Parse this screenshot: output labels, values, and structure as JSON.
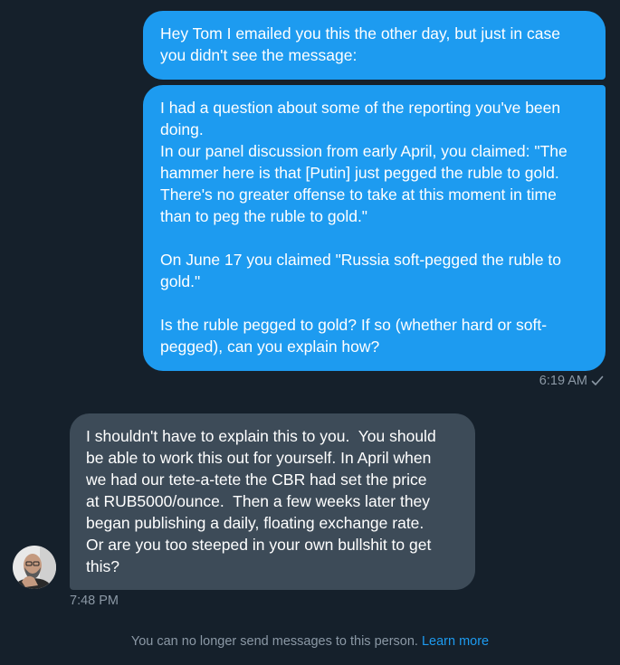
{
  "conversation": {
    "sent_messages": [
      {
        "text": "Hey Tom I emailed you this the other day, but just in case\nyou didn't see the message:"
      },
      {
        "text": "I had a question about some of the reporting you've been\ndoing.\nIn our panel discussion from early April, you claimed: \"The\nhammer here is that [Putin] just pegged the ruble to gold.\nThere's no greater offense to take at this moment in time\nthan to peg the ruble to gold.\"\n\nOn June 17 you claimed \"Russia soft-pegged the ruble to\ngold.\"\n\nIs the ruble pegged to gold? If so (whether hard or soft-\npegged), can you explain how?"
      }
    ],
    "sent_time": "6:19 AM",
    "sent_status_icon": "check-icon",
    "received_message": {
      "text": "I shouldn't have to explain this to you.  You should\nbe able to work this out for yourself. In April when\nwe had our tete-a-tete the CBR had set the price\nat RUB5000/ounce.  Then a few weeks later they\nbegan publishing a daily, floating exchange rate.\nOr are you too steeped in your own bullshit to get\nthis?"
    },
    "received_time": "7:48 PM",
    "footer": {
      "notice": "You can no longer send messages to this person.",
      "link": "Learn more"
    }
  },
  "colors": {
    "background": "#15202b",
    "sent_bubble": "#1d9bf0",
    "received_bubble": "#3d4b58",
    "muted_text": "#8b98a5",
    "link": "#1d9bf0"
  }
}
